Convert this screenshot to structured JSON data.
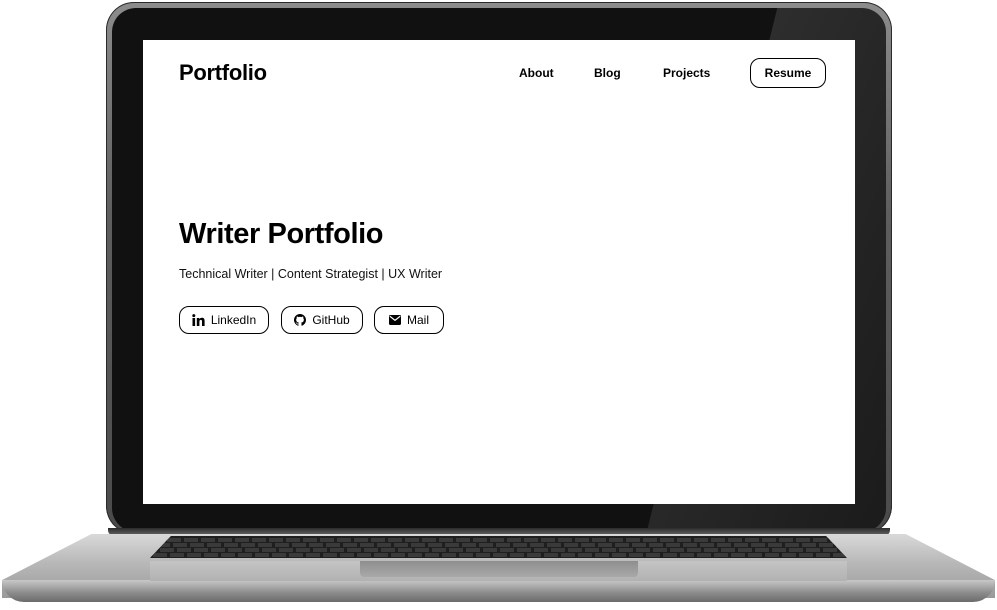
{
  "header": {
    "logo": "Portfolio",
    "nav": {
      "about": "About",
      "blog": "Blog",
      "projects": "Projects"
    },
    "resume_label": "Resume"
  },
  "hero": {
    "title": "Writer Portfolio",
    "subtitle": "Technical Writer | Content Strategist | UX Writer"
  },
  "social": {
    "linkedin": {
      "label": "LinkedIn",
      "icon": "linkedin-icon"
    },
    "github": {
      "label": "GitHub",
      "icon": "github-icon"
    },
    "mail": {
      "label": "Mail",
      "icon": "envelope-icon"
    }
  },
  "colors": {
    "text": "#000000",
    "background": "#ffffff",
    "device_bezel": "#111111"
  }
}
